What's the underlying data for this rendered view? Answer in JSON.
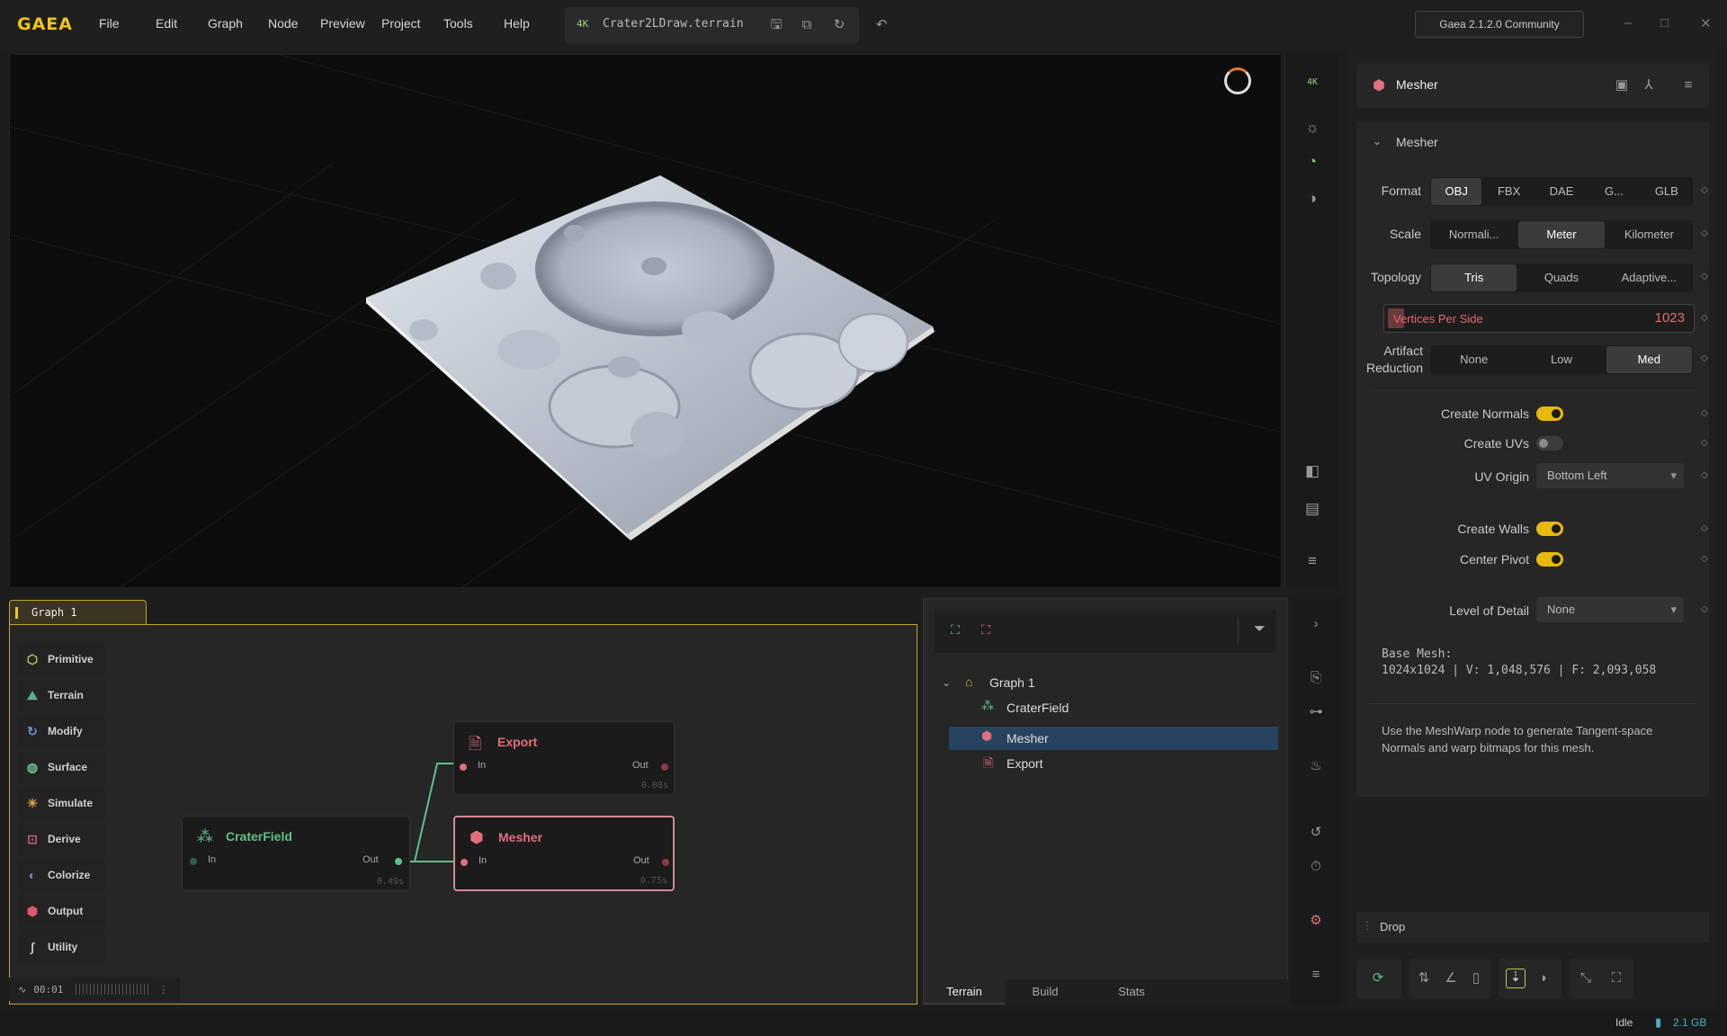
{
  "app": {
    "logo": "GAEA",
    "version": "Gaea 2.1.2.0 Community"
  },
  "menu": [
    "File",
    "Edit",
    "Graph",
    "Node",
    "Preview",
    "Project",
    "Tools",
    "Help"
  ],
  "file": {
    "resolution": "4K",
    "name": "Crater2LDraw.terrain"
  },
  "viewport": {
    "resolution_badge": "4K"
  },
  "graph": {
    "tab": "Graph 1",
    "palette": [
      {
        "label": "Primitive",
        "icon": "cube-icon",
        "color": "#b7cc5a"
      },
      {
        "label": "Terrain",
        "icon": "terrain-icon",
        "color": "#5fb08a"
      },
      {
        "label": "Modify",
        "icon": "modify-icon",
        "color": "#6d8fd6"
      },
      {
        "label": "Surface",
        "icon": "surface-icon",
        "color": "#6ac08a"
      },
      {
        "label": "Simulate",
        "icon": "simulate-icon",
        "color": "#e0a040"
      },
      {
        "label": "Derive",
        "icon": "derive-icon",
        "color": "#c05a80"
      },
      {
        "label": "Colorize",
        "icon": "colorize-icon",
        "color": "#8a7ad6"
      },
      {
        "label": "Output",
        "icon": "output-icon",
        "color": "#e05a6a"
      },
      {
        "label": "Utility",
        "icon": "utility-icon",
        "color": "#c0c0c0"
      }
    ],
    "nodes": {
      "export": {
        "title": "Export",
        "in": "In",
        "out": "Out",
        "time": "0.08s",
        "color": "#e0707a"
      },
      "mesher": {
        "title": "Mesher",
        "in": "In",
        "out": "Out",
        "time": "0.75s",
        "color": "#e0707a"
      },
      "craterfield": {
        "title": "CraterField",
        "in": "In",
        "out": "Out",
        "time": "0.49s",
        "color": "#5fc08a"
      }
    },
    "timer": "00:01"
  },
  "tree": {
    "root": "Graph 1",
    "items": [
      "CraterField",
      "Mesher",
      "Export"
    ],
    "selected": "Mesher",
    "tabs": [
      "Terrain",
      "Build",
      "Stats"
    ],
    "active_tab": "Terrain"
  },
  "props": {
    "header_title": "Mesher",
    "section": "Mesher",
    "format": {
      "label": "Format",
      "options": [
        "OBJ",
        "FBX",
        "DAE",
        "G...",
        "GLB"
      ],
      "selected": "OBJ"
    },
    "scale": {
      "label": "Scale",
      "options": [
        "Normali...",
        "Meter",
        "Kilometer"
      ],
      "selected": "Meter"
    },
    "topology": {
      "label": "Topology",
      "options": [
        "Tris",
        "Quads",
        "Adaptive..."
      ],
      "selected": "Tris"
    },
    "vertices": {
      "label": "Vertices Per Side",
      "value": "1023"
    },
    "artifact": {
      "label1": "Artifact",
      "label2": "Reduction",
      "options": [
        "None",
        "Low",
        "Med"
      ],
      "selected": "Med"
    },
    "create_normals": {
      "label": "Create Normals",
      "on": true
    },
    "create_uvs": {
      "label": "Create UVs",
      "on": false
    },
    "uv_origin": {
      "label": "UV Origin",
      "value": "Bottom Left"
    },
    "create_walls": {
      "label": "Create Walls",
      "on": true
    },
    "center_pivot": {
      "label": "Center Pivot",
      "on": true
    },
    "lod": {
      "label": "Level of Detail",
      "value": "None"
    },
    "base_mesh_title": "Base Mesh:",
    "base_mesh_info": "1024x1024 | V: 1,048,576 | F: 2,093,058",
    "hint": "Use the MeshWarp node to generate Tangent-space Normals and warp bitmaps for this mesh.",
    "drop": "Drop"
  },
  "status": {
    "state": "Idle",
    "memory": "2.1 GB"
  }
}
